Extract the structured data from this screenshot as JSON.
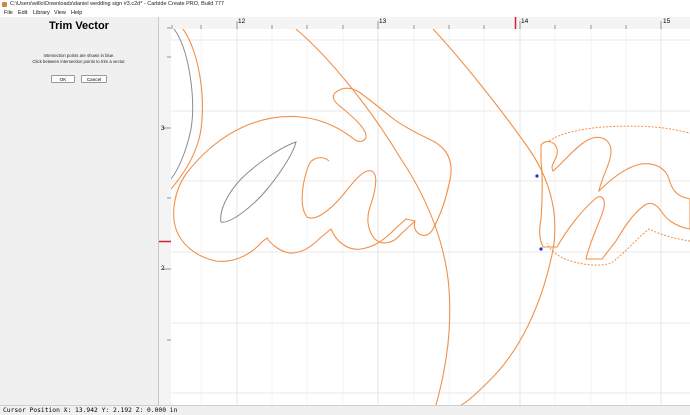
{
  "window": {
    "title": "C:\\Users\\willo\\Downloads\\daniel wedding sign #3.c2d* - Carbide Create PRO, Build 777"
  },
  "menu": {
    "items": [
      "File",
      "Edit",
      "Library",
      "View",
      "Help"
    ]
  },
  "panel": {
    "heading": "Trim Vector",
    "info_line1": "Intersection points are shown in blue.",
    "info_line2": "Click between intersection points to trim a vector.",
    "ok_label": "OK",
    "cancel_label": "Cancel"
  },
  "rulers": {
    "top_labels": [
      "12",
      "13",
      "14",
      "15"
    ],
    "left_labels": [
      "3",
      "2"
    ]
  },
  "status": {
    "cursor_text": "Cursor Position X: 13.942 Y: 2.192 Z: 0.000 in"
  },
  "colors": {
    "vector_orange": "#f0914a",
    "vector_gray": "#8c8c8c",
    "intersection_blue": "#1a35c9",
    "ruler_marker_red": "#d8202a"
  }
}
